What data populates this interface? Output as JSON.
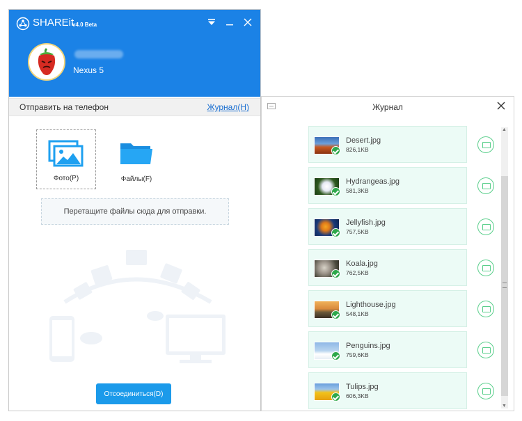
{
  "app": {
    "title": "SHAREit",
    "version": "v4.0 Beta"
  },
  "device": {
    "name": "Nexus 5"
  },
  "sendbar": {
    "label": "Отправить на телефон",
    "journal_link": "Журнал(H)"
  },
  "tiles": {
    "photo_label": "Фото(P)",
    "files_label": "Файлы(F)"
  },
  "dropzone": {
    "text": "Перетащите файлы сюда для отправки."
  },
  "disconnect": {
    "label": "Отсоединиться(D)"
  },
  "journal": {
    "title": "Журнал",
    "items": [
      {
        "name": "Desert.jpg",
        "size": "826,1KB"
      },
      {
        "name": "Hydrangeas.jpg",
        "size": "581,3KB"
      },
      {
        "name": "Jellyfish.jpg",
        "size": "757,5KB"
      },
      {
        "name": "Koala.jpg",
        "size": "762,5KB"
      },
      {
        "name": "Lighthouse.jpg",
        "size": "548,1KB"
      },
      {
        "name": "Penguins.jpg",
        "size": "759,6KB"
      },
      {
        "name": "Tulips.jpg",
        "size": "606,3KB"
      }
    ]
  },
  "colors": {
    "accent": "#1b82e6",
    "button": "#1b9aea",
    "success": "#2ea84b",
    "row_bg": "#ecfbf6"
  },
  "icons": {
    "logo": "shareit-logo-icon",
    "menu": "menu-down-icon",
    "minimize": "minimize-icon",
    "close": "close-icon",
    "photo": "photo-icon",
    "folder": "folder-icon",
    "download": "download-to-pc-icon",
    "check": "check-icon"
  }
}
